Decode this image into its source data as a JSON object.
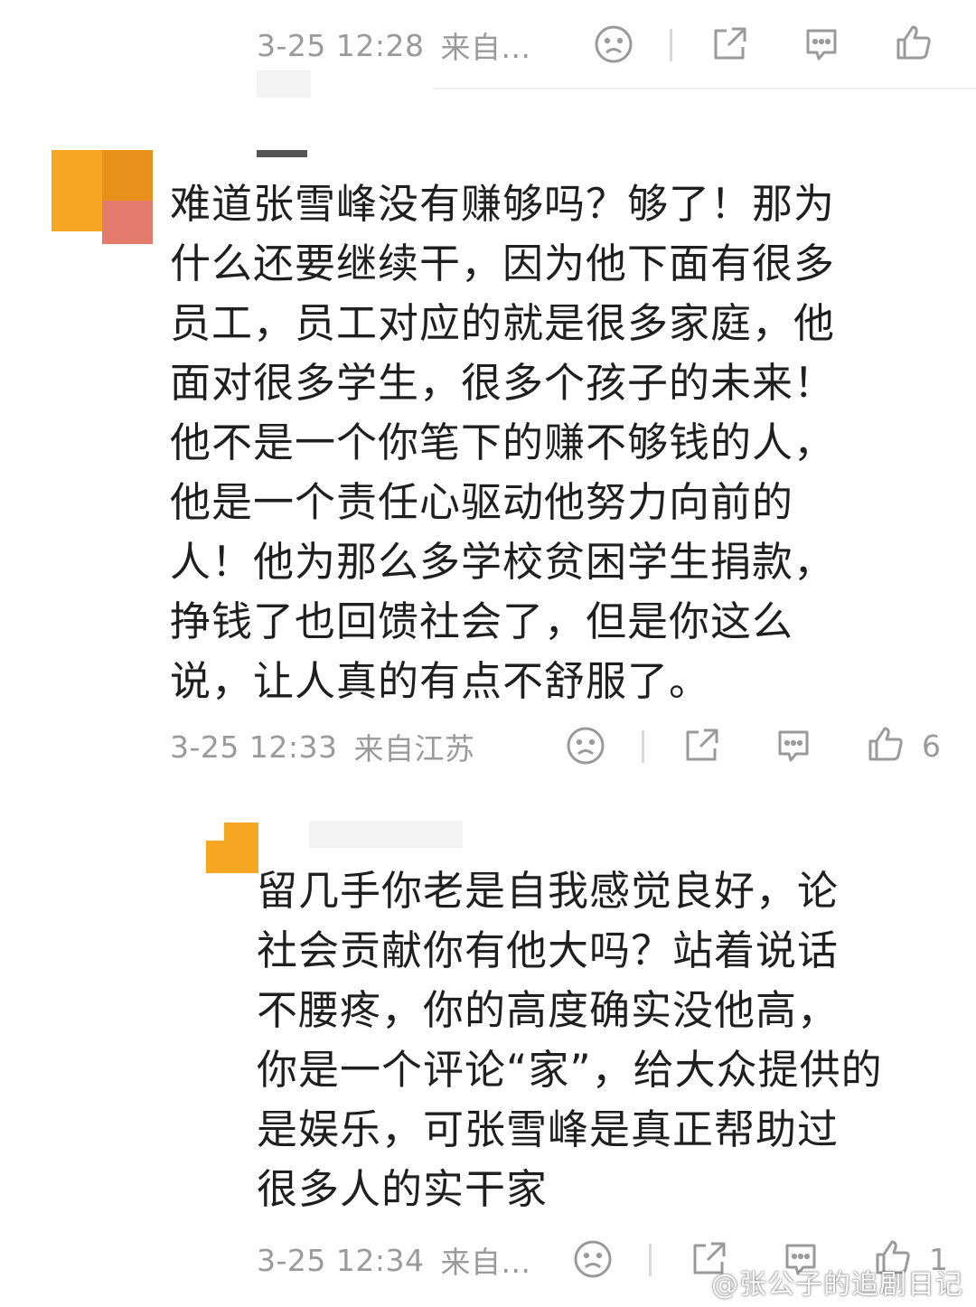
{
  "top_meta": {
    "time": "3-25 12:28",
    "source": "来自..."
  },
  "comment1": {
    "text": "难道张雪峰没有赚够吗？够了！那为\n什么还要继续干，因为他下面有很多\n员工，员工对应的就是很多家庭，他\n面对很多学生，很多个孩子的未来！\n他不是一个你笔下的赚不够钱的人，\n他是一个责任心驱动他努力向前的\n人！他为那么多学校贫困学生捐款，\n挣钱了也回馈社会了，但是你这么\n说，让人真的有点不舒服了。",
    "time": "3-25 12:33",
    "source": "来自江苏",
    "likes": "6"
  },
  "reply": {
    "text": "留几手你老是自我感觉良好，论\n社会贡献你有他大吗？站着说话\n不腰疼，你的高度确实没他高，\n你是一个评论“家”，给大众提供的\n是娱乐，可张雪峰是真正帮助过\n很多人的实干家",
    "time": "3-25 12:34",
    "source": "来自...",
    "likes": "1"
  },
  "watermark": "@张公子的追剧日记",
  "icons": [
    "sad-face-icon",
    "share-icon",
    "comment-icon",
    "thumbs-up-icon"
  ],
  "colors": {
    "avatar_orange": "#f5a623",
    "avatar_dark": "#e8901a",
    "avatar_pink": "#e47a6c",
    "meta_gray": "#9a9a9a",
    "text": "#1f1f1f"
  }
}
